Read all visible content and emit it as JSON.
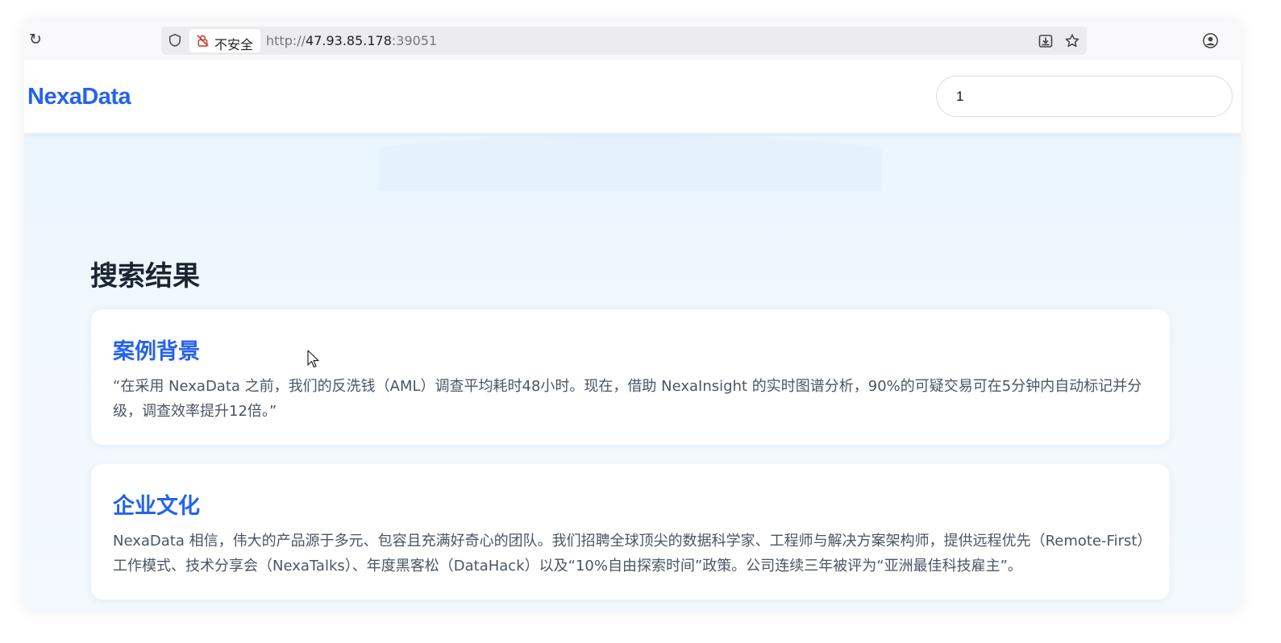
{
  "browser": {
    "security_label": "不安全",
    "url_prefix": "http://",
    "url_host": "47.93.85.178",
    "url_port": ":39051"
  },
  "site": {
    "logo": "NexaData",
    "search_value": "1"
  },
  "results": {
    "heading": "搜索结果",
    "items": [
      {
        "title": "案例背景",
        "body": "“在采用 NexaData 之前，我们的反洗钱（AML）调查平均耗时48小时。现在，借助 NexaInsight 的实时图谱分析，90%的可疑交易可在5分钟内自动标记并分级，调查效率提升12倍。”"
      },
      {
        "title": "企业文化",
        "body": "NexaData 相信，伟大的产品源于多元、包容且充满好奇心的团队。我们招聘全球顶尖的数据科学家、工程师与解决方案架构师，提供远程优先（Remote-First）工作模式、技术分享会（NexaTalks）、年度黑客松（DataHack）以及“10%自由探索时间”政策。公司连续三年被评为“亚洲最佳科技雇主”。"
      }
    ]
  },
  "colors": {
    "brand": "#2563eb",
    "heading": "#1b2433",
    "body_text": "#4b5563"
  },
  "icons": [
    "reload-icon",
    "shield-icon",
    "insecure-lock-icon",
    "save-page-icon",
    "bookmark-star-icon",
    "profile-icon",
    "overflow-menu-icon"
  ]
}
